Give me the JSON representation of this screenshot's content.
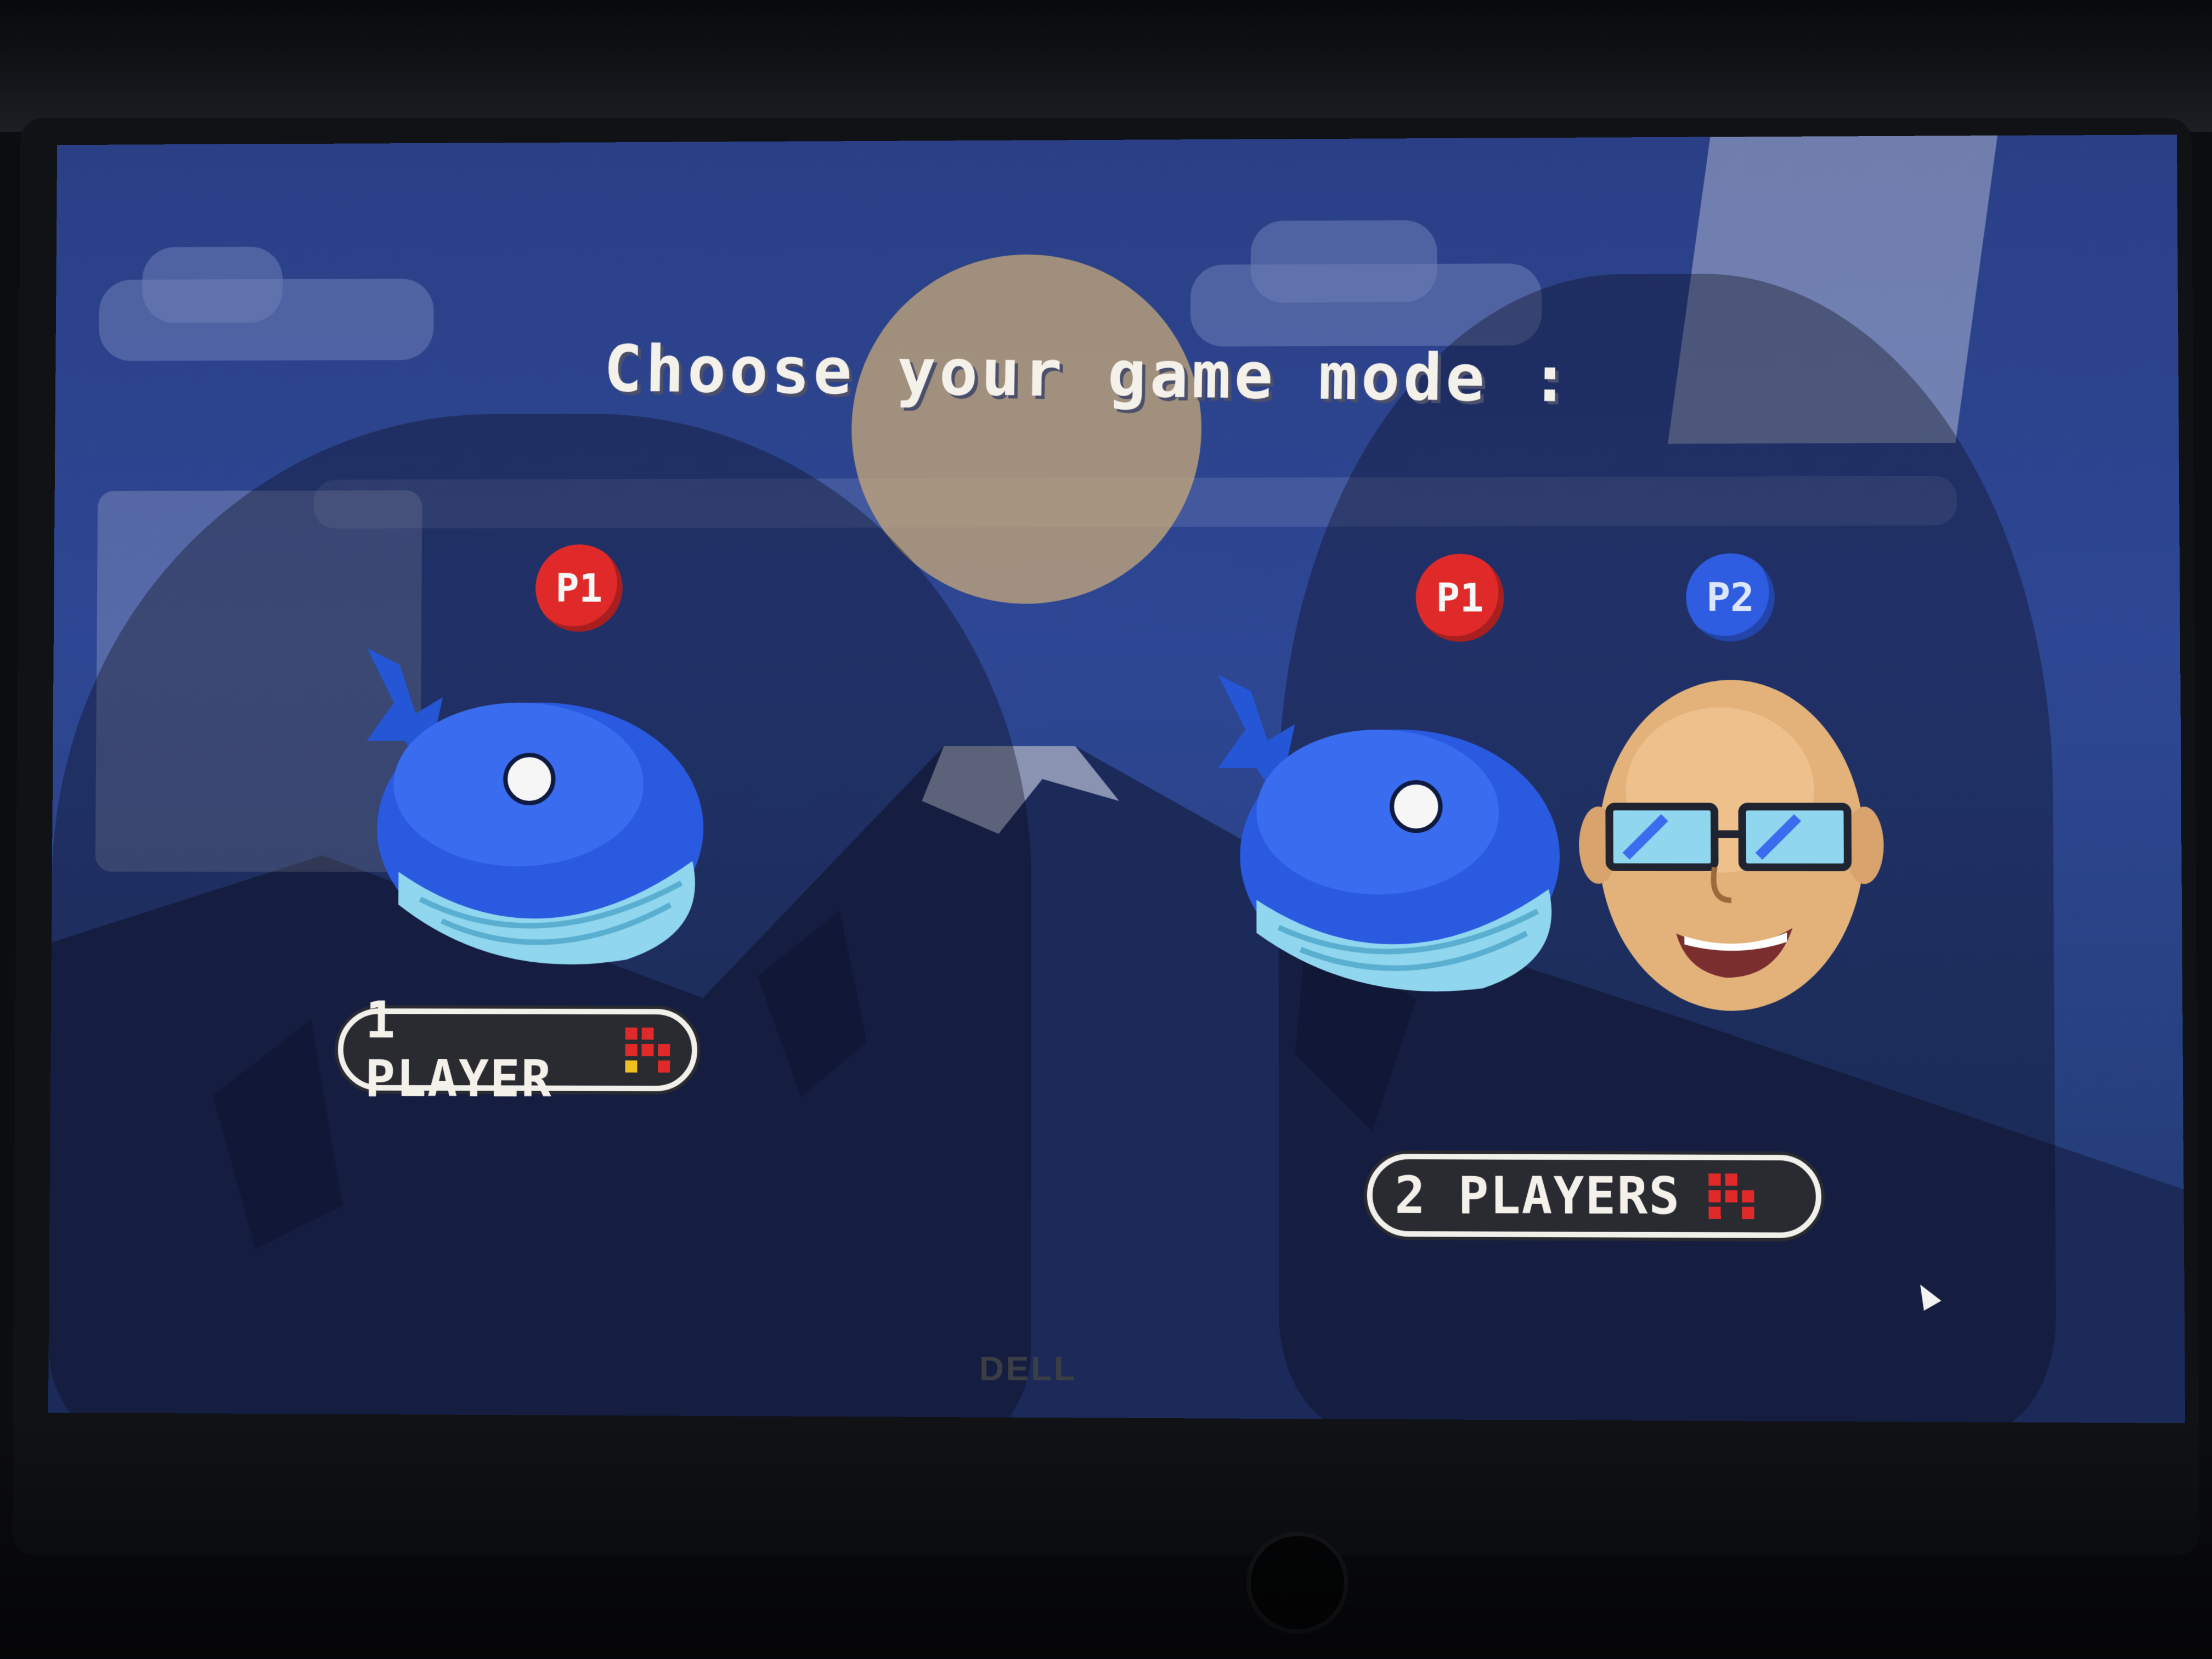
{
  "screen": {
    "title": "Choose your game mode :"
  },
  "modes": [
    {
      "label": "1 PLAYER",
      "badges": [
        "P1"
      ],
      "characters": [
        "whale-icon"
      ],
      "badge_colors": [
        "#e02a2a"
      ]
    },
    {
      "label": "2 PLAYERS",
      "badges": [
        "P1",
        "P2"
      ],
      "characters": [
        "whale-icon",
        "bald-man-icon"
      ],
      "badge_colors": [
        "#e02a2a",
        "#2f5de2"
      ]
    }
  ],
  "monitor": {
    "brand": "DELL"
  },
  "colors": {
    "sky": "#2e4794",
    "title_text": "#f4f1ea",
    "whale_body": "#2a5ae0",
    "whale_belly": "#8fd6ee",
    "pill_border": "#f2f0ea"
  }
}
